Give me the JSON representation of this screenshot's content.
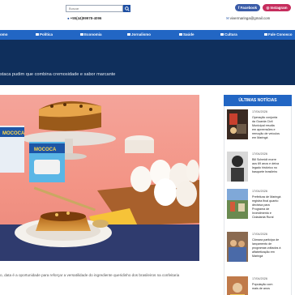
{
  "header": {
    "search_placeholder": "Buscar",
    "phone": "+55(44)99978-4096",
    "facebook_label": "Facebook",
    "instagram_label": "Instagram",
    "email": "vivermaringa@gmail.com"
  },
  "nav": {
    "items": [
      {
        "label": "omo"
      },
      {
        "label": "Política"
      },
      {
        "label": "Economia"
      },
      {
        "label": "Jornalismo"
      },
      {
        "label": "Saúde"
      },
      {
        "label": "Cultura"
      },
      {
        "label": "Fale Conosco"
      }
    ]
  },
  "article": {
    "headline": "staca pudim que combina cremosidade e sabor marcante",
    "caption": "o, data é a oportunidade para reforçar a versatilidade do ingrediente queridinho dos brasileiros na confeitaria",
    "image_brand": "MOCOCA"
  },
  "sidebar": {
    "heading": "ÚLTIMAS NOTÍCIAS",
    "news": [
      {
        "date": "17/04/2026",
        "lines": [
          "Operação conjunta",
          "da Guarda Civil",
          "Municipal resulta",
          "em apreensões e",
          "remoção de veículos",
          "em Maringá"
        ]
      },
      {
        "date": "17/04/2026",
        "lines": [
          "Bill Schmidt morre",
          "aos 69 anos e deixa",
          "legado histórico no",
          "basquete brasileiro"
        ]
      },
      {
        "date": "17/04/2026",
        "lines": [
          "Prefeitura de Maringá",
          "registra final quanto",
          "decisiva para",
          "Programa de",
          "Investimento e",
          "Cidadania Rural"
        ]
      },
      {
        "date": "17/04/2026",
        "lines": [
          "Câmara participa de",
          "lançamento de",
          "programas voltados à",
          "alfabetização em",
          "Maringá"
        ]
      },
      {
        "date": "17/04/2026",
        "lines": [
          "População com",
          "mais de anos"
        ]
      }
    ]
  }
}
